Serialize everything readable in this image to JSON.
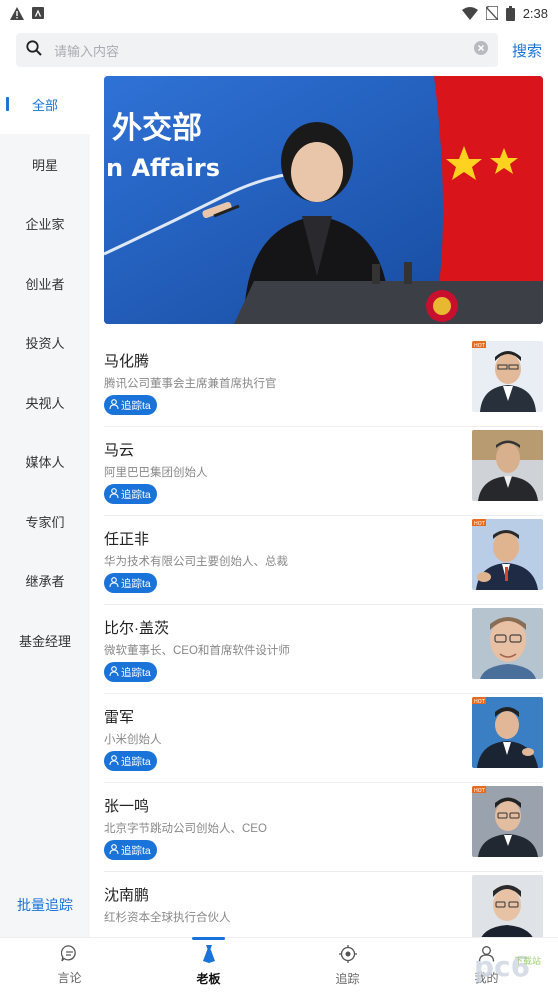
{
  "status_bar": {
    "time": "2:38"
  },
  "search": {
    "placeholder": "请输入内容",
    "button_label": "搜索"
  },
  "sidebar": {
    "items": [
      {
        "label": "全部",
        "active": true
      },
      {
        "label": "明星"
      },
      {
        "label": "企业家"
      },
      {
        "label": "创业者"
      },
      {
        "label": "投资人"
      },
      {
        "label": "央视人"
      },
      {
        "label": "媒体人"
      },
      {
        "label": "专家们"
      },
      {
        "label": "继承者"
      },
      {
        "label": "基金经理"
      }
    ],
    "batch_follow_label": "批量追踪"
  },
  "banner": {
    "backdrop_text_1": "外交部",
    "backdrop_text_2": "n Affairs"
  },
  "people": [
    {
      "name": "马化腾",
      "title": "腾讯公司董事会主席兼首席执行官",
      "follow_label": "追踪ta",
      "badge": "HOT"
    },
    {
      "name": "马云",
      "title": "阿里巴巴集团创始人",
      "follow_label": "追踪ta",
      "badge": ""
    },
    {
      "name": "任正非",
      "title": "华为技术有限公司主要创始人、总裁",
      "follow_label": "追踪ta",
      "badge": "HOT"
    },
    {
      "name": "比尔·盖茨",
      "title": "微软董事长、CEO和首席软件设计师",
      "follow_label": "追踪ta",
      "badge": ""
    },
    {
      "name": "雷军",
      "title": "小米创始人",
      "follow_label": "追踪ta",
      "badge": "HOT"
    },
    {
      "name": "张一鸣",
      "title": "北京字节跳动公司创始人、CEO",
      "follow_label": "追踪ta",
      "badge": "HOT"
    },
    {
      "name": "沈南鹏",
      "title": "红杉资本全球执行合伙人",
      "follow_label": "追踪ta",
      "badge": ""
    }
  ],
  "bottom_nav": {
    "items": [
      {
        "label": "言论",
        "icon": "chat-bubble-icon"
      },
      {
        "label": "老板",
        "icon": "tie-icon",
        "active": true
      },
      {
        "label": "追踪",
        "icon": "target-icon"
      },
      {
        "label": "我的",
        "icon": "profile-icon"
      }
    ]
  },
  "watermark": {
    "text": "pc6",
    "sub": "下载站"
  },
  "colors": {
    "accent": "#1a73d9",
    "sidebar_bg": "#f5f6f8",
    "search_bg": "#f1f2f4"
  }
}
